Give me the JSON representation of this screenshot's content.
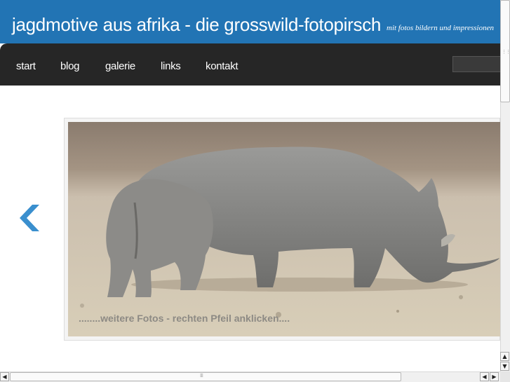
{
  "stray_text": "-->",
  "header": {
    "title": "jagdmotive aus afrika - die grosswild-fotopirsch",
    "tagline": "mit fotos bildern und impressionen"
  },
  "nav": {
    "items": [
      "start",
      "blog",
      "galerie",
      "links",
      "kontakt"
    ]
  },
  "search": {
    "placeholder": ""
  },
  "slider": {
    "caption": "........weitere Fotos - rechten Pfeil anklicken....",
    "prev_icon": "chevron-left-icon"
  },
  "colors": {
    "header_bg": "#2274b4",
    "nav_bg": "#262626",
    "arrow": "#3a8fce",
    "caption": "#8d8a84"
  }
}
